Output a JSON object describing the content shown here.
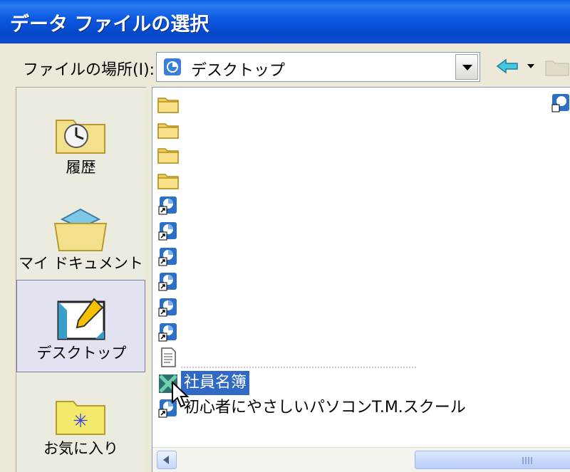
{
  "window": {
    "title": "データ ファイルの選択"
  },
  "lookin": {
    "label": "ファイルの場所(I):",
    "value": "デスクトップ"
  },
  "places": [
    {
      "label": "履歴",
      "icon": "history-icon"
    },
    {
      "label": "マイ ドキュメント",
      "icon": "my-documents-icon"
    },
    {
      "label": "デスクトップ",
      "icon": "desktop-icon",
      "selected": true
    },
    {
      "label": "お気に入り",
      "icon": "favorites-icon"
    }
  ],
  "files": [
    {
      "name": "",
      "icon": "folder-icon"
    },
    {
      "name": "",
      "icon": "folder-icon"
    },
    {
      "name": "",
      "icon": "folder-icon"
    },
    {
      "name": "",
      "icon": "folder-icon"
    },
    {
      "name": "",
      "icon": "shortcut-icon"
    },
    {
      "name": "",
      "icon": "shortcut-icon"
    },
    {
      "name": "",
      "icon": "shortcut-icon"
    },
    {
      "name": "",
      "icon": "shortcut-icon"
    },
    {
      "name": "",
      "icon": "shortcut-icon"
    },
    {
      "name": "",
      "icon": "shortcut-icon"
    },
    {
      "name": "",
      "icon": "text-file-icon"
    },
    {
      "name": "社員名簿",
      "icon": "access-db-icon",
      "selected": true
    },
    {
      "name": "初心者にやさしいパソコンT.M.スクール",
      "icon": "shortcut-icon"
    }
  ],
  "colors": {
    "titlebar": "#0a58e0",
    "selection": "#316ac5",
    "background": "#ece9d8"
  }
}
